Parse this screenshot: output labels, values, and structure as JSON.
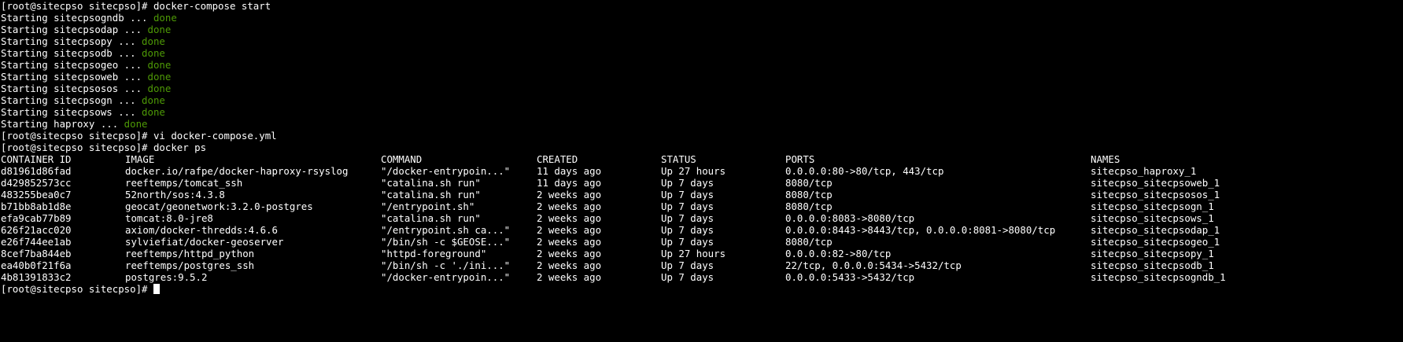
{
  "session": {
    "prompt": "[root@sitecpso sitecpso]# ",
    "commands": {
      "start": "docker-compose start",
      "edit": "vi docker-compose.yml",
      "ps": "docker ps"
    },
    "start_output": [
      {
        "text": "Starting sitecpsogndb ... ",
        "status": "done"
      },
      {
        "text": "Starting sitecpsodap ... ",
        "status": "done"
      },
      {
        "text": "Starting sitecpsopy ... ",
        "status": "done"
      },
      {
        "text": "Starting sitecpsodb ... ",
        "status": "done"
      },
      {
        "text": "Starting sitecpsogeo ... ",
        "status": "done"
      },
      {
        "text": "Starting sitecpsoweb ... ",
        "status": "done"
      },
      {
        "text": "Starting sitecpsosos ... ",
        "status": "done"
      },
      {
        "text": "Starting sitecpsogn ... ",
        "status": "done"
      },
      {
        "text": "Starting sitecpsows ... ",
        "status": "done"
      },
      {
        "text": "Starting haproxy ... ",
        "status": "done"
      }
    ]
  },
  "ps_table": {
    "headers": {
      "container_id": "CONTAINER ID",
      "image": "IMAGE",
      "command": "COMMAND",
      "created": "CREATED",
      "status": "STATUS",
      "ports": "PORTS",
      "names": "NAMES"
    },
    "rows": [
      {
        "container_id": "d81961d86fad",
        "image": "docker.io/rafpe/docker-haproxy-rsyslog",
        "command": "\"/docker-entrypoin...\"",
        "created": "11 days ago",
        "status": "Up 27 hours",
        "ports": "0.0.0.0:80->80/tcp, 443/tcp",
        "names": "sitecpso_haproxy_1"
      },
      {
        "container_id": "d429852573cc",
        "image": "reeftemps/tomcat_ssh",
        "command": "\"catalina.sh run\"",
        "created": "11 days ago",
        "status": "Up 7 days",
        "ports": "8080/tcp",
        "names": "sitecpso_sitecpsoweb_1"
      },
      {
        "container_id": "483255bea0c7",
        "image": "52north/sos:4.3.8",
        "command": "\"catalina.sh run\"",
        "created": "2 weeks ago",
        "status": "Up 7 days",
        "ports": "8080/tcp",
        "names": "sitecpso_sitecpsosos_1"
      },
      {
        "container_id": "b71bb8ab1d8e",
        "image": "geocat/geonetwork:3.2.0-postgres",
        "command": "\"/entrypoint.sh\"",
        "created": "2 weeks ago",
        "status": "Up 7 days",
        "ports": "8080/tcp",
        "names": "sitecpso_sitecpsogn_1"
      },
      {
        "container_id": "efa9cab77b89",
        "image": "tomcat:8.0-jre8",
        "command": "\"catalina.sh run\"",
        "created": "2 weeks ago",
        "status": "Up 7 days",
        "ports": "0.0.0.0:8083->8080/tcp",
        "names": "sitecpso_sitecpsows_1"
      },
      {
        "container_id": "626f21acc020",
        "image": "axiom/docker-thredds:4.6.6",
        "command": "\"/entrypoint.sh ca...\"",
        "created": "2 weeks ago",
        "status": "Up 7 days",
        "ports": "0.0.0.0:8443->8443/tcp, 0.0.0.0:8081->8080/tcp",
        "names": "sitecpso_sitecpsodap_1"
      },
      {
        "container_id": "e26f744ee1ab",
        "image": "sylviefiat/docker-geoserver",
        "command": "\"/bin/sh -c $GEOSE...\"",
        "created": "2 weeks ago",
        "status": "Up 7 days",
        "ports": "8080/tcp",
        "names": "sitecpso_sitecpsogeo_1"
      },
      {
        "container_id": "8cef7ba844eb",
        "image": "reeftemps/httpd_python",
        "command": "\"httpd-foreground\"",
        "created": "2 weeks ago",
        "status": "Up 27 hours",
        "ports": "0.0.0.0:82->80/tcp",
        "names": "sitecpso_sitecpsopy_1"
      },
      {
        "container_id": "ea40b0f21f6a",
        "image": "reeftemps/postgres_ssh",
        "command": "\"/bin/sh -c './ini...\"",
        "created": "2 weeks ago",
        "status": "Up 7 days",
        "ports": "22/tcp, 0.0.0.0:5434->5432/tcp",
        "names": "sitecpso_sitecpsodb_1"
      },
      {
        "container_id": "4b81391833c2",
        "image": "postgres:9.5.2",
        "command": "\"/docker-entrypoin...\"",
        "created": "2 weeks ago",
        "status": "Up 7 days",
        "ports": "0.0.0.0:5433->5432/tcp",
        "names": "sitecpso_sitecpsogndb_1"
      }
    ]
  },
  "colors": {
    "background": "#000000",
    "foreground": "#ffffff",
    "done": "#4e9a06"
  }
}
